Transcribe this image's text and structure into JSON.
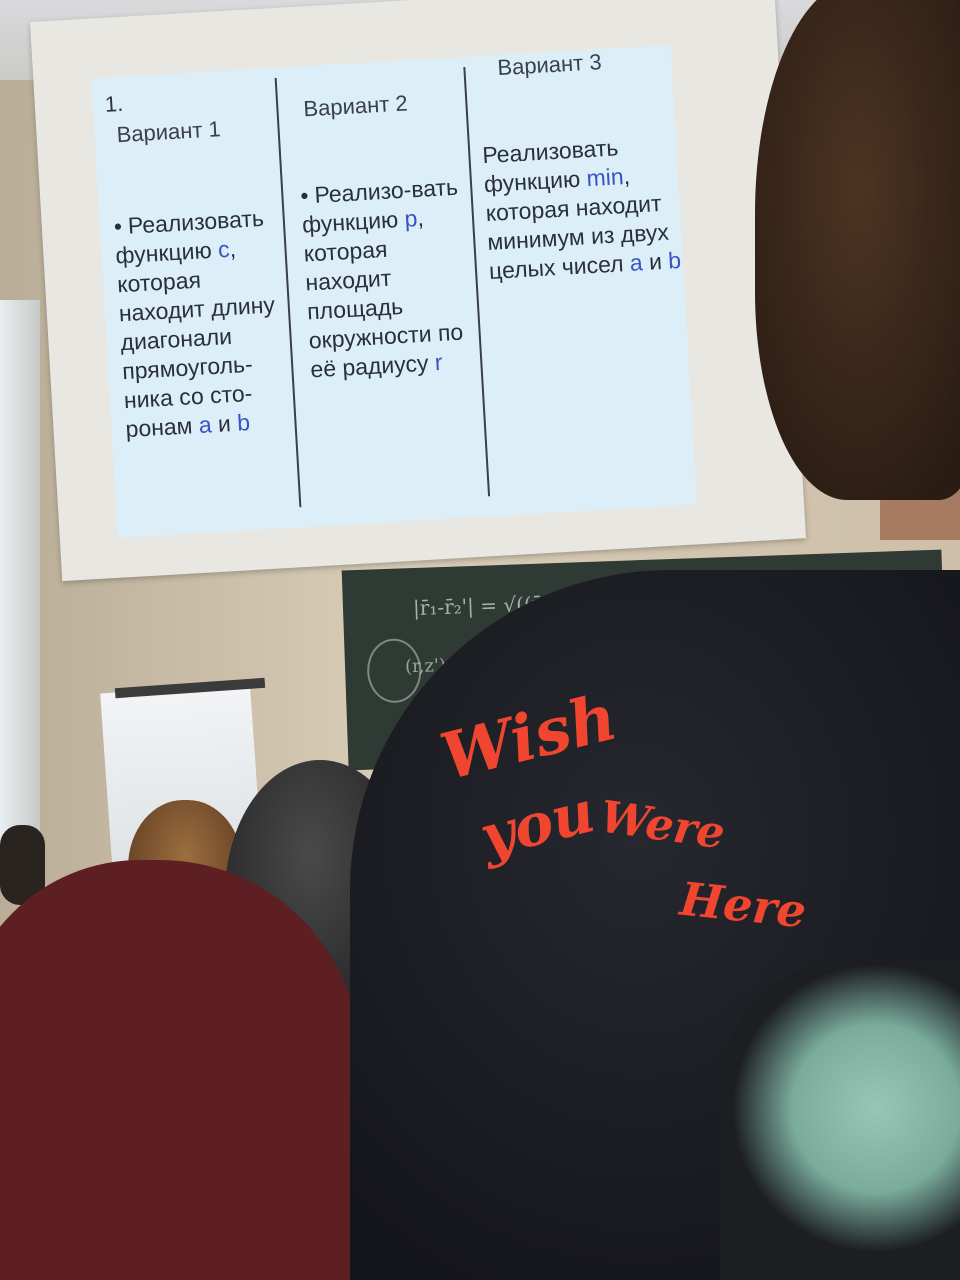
{
  "photo": {
    "description_tag": "lecture-room",
    "slide": {
      "number": "1.",
      "columns": [
        {
          "heading": "Вариант 1",
          "bullet": "•",
          "text_before": "Реализовать функцию ",
          "var1": "c",
          "text_middle": ", которая находит длину диагонали прямоуголь-ника со сто-ронам ",
          "var2": "a",
          "conj": " и ",
          "var3": "b"
        },
        {
          "heading": "Вариант 2",
          "bullet": "•",
          "text_before": "Реализо-вать функцию ",
          "var1": "p",
          "text_middle": ", которая находит площадь окружности по её радиусу ",
          "var2": "r"
        },
        {
          "heading": "Вариант 3",
          "text_before": "Реализовать функцию ",
          "var1": "min",
          "text_middle": ", которая находит минимум из двух целых чисел ",
          "var2": "a",
          "conj": " и ",
          "var3": "b"
        }
      ]
    },
    "chalkboard": {
      "formula_line1": "|r̄₁-r̄₂'| = √((r̄-r̄')·(r̄-r̄'))",
      "formula_line2": "(r,z')"
    },
    "shirt_print": {
      "line1": "Wish",
      "line2": "you",
      "line3": "Were",
      "line4": "Here"
    },
    "colors": {
      "slide_background": "#dceff8",
      "variable_highlight": "#3b52c4",
      "print_red": "#f0452f"
    }
  }
}
